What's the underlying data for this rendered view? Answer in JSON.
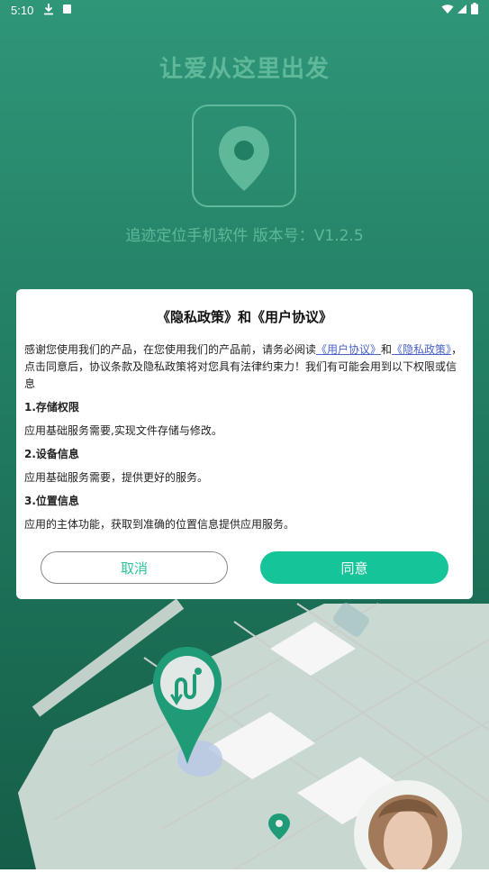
{
  "status_bar": {
    "time": "5:10"
  },
  "header": {
    "title": "让爱从这里出发",
    "version_text": "追迹定位手机软件  版本号：V1.2.5"
  },
  "dialog": {
    "title": "《隐私政策》和《用户协议》",
    "intro_prefix": "感谢您使用我们的产品，在您使用我们的产品前，请务必阅读",
    "link_user_agreement": "《用户协议》",
    "intro_and": "和",
    "link_privacy_policy": "《隐私政策》",
    "intro_suffix": "，点击同意后，协议条款及隐私政策将对您具有法律约束力！我们有可能会用到以下权限或信息",
    "sections": [
      {
        "heading": "1.存储权限",
        "text": "应用基础服务需要,实现文件存储与修改。"
      },
      {
        "heading": "2.设备信息",
        "text": "应用基础服务需要，提供更好的服务。"
      },
      {
        "heading": "3.位置信息",
        "text": "应用的主体功能，获取到准确的位置信息提供应用服务。"
      }
    ],
    "cancel_label": "取消",
    "agree_label": "同意"
  },
  "colors": {
    "background": "#237f64",
    "accent": "#15c498",
    "link": "#4a62c9"
  }
}
